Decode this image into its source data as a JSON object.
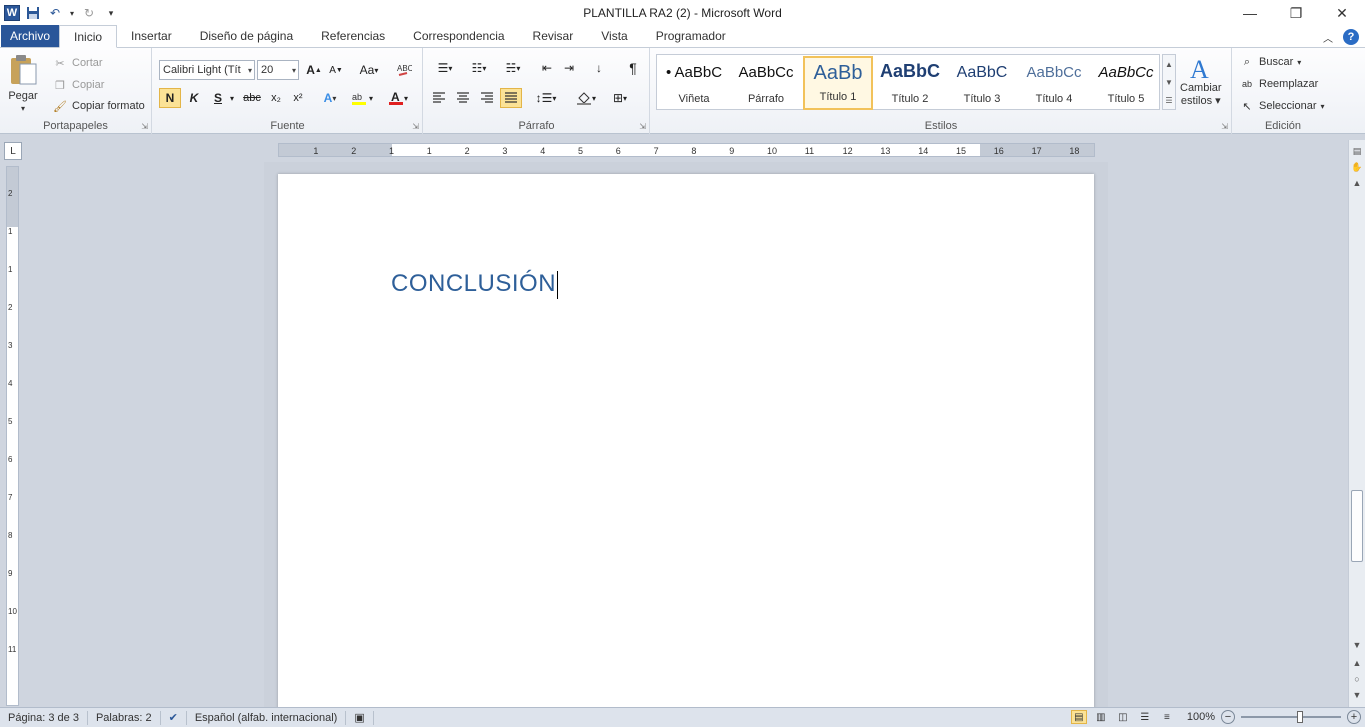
{
  "window": {
    "title": "PLANTILLA RA2 (2)  -  Microsoft Word",
    "app_logo": "W",
    "controls": {
      "minimize": "—",
      "restore": "❐",
      "close": "✕"
    }
  },
  "tabs": [
    {
      "label": "Archivo"
    },
    {
      "label": "Inicio"
    },
    {
      "label": "Insertar"
    },
    {
      "label": "Diseño de página"
    },
    {
      "label": "Referencias"
    },
    {
      "label": "Correspondencia"
    },
    {
      "label": "Revisar"
    },
    {
      "label": "Vista"
    },
    {
      "label": "Programador"
    }
  ],
  "ribbon": {
    "clipboard": {
      "label": "Portapapeles",
      "paste": "Pegar",
      "cut": "Cortar",
      "copy": "Copiar",
      "format_painter": "Copiar formato"
    },
    "font": {
      "label": "Fuente",
      "font_name": "Calibri Light (Tít",
      "font_size": "20",
      "bold": "N",
      "italic": "K",
      "underline": "S",
      "strike": "abc",
      "subscript": "x₂",
      "superscript": "x²",
      "grow": "A",
      "shrink": "A",
      "case": "Aa"
    },
    "paragraph": {
      "label": "Párrafo",
      "pilcrow": "¶"
    },
    "styles": {
      "label": "Estilos",
      "items": [
        {
          "preview": "• AaBbC",
          "name": "Viñeta"
        },
        {
          "preview": "AaBbCc",
          "name": "Párrafo"
        },
        {
          "preview": "AaBb",
          "name": "Título 1"
        },
        {
          "preview": "AaBbC",
          "name": "Título 2"
        },
        {
          "preview": "AaBbC",
          "name": "Título 3"
        },
        {
          "preview": "AaBbCc",
          "name": "Título 4"
        },
        {
          "preview": "AaBbCc",
          "name": "Título 5"
        }
      ],
      "change_styles_1": "Cambiar",
      "change_styles_2": "estilos"
    },
    "editing": {
      "label": "Edición",
      "find": "Buscar",
      "replace": "Reemplazar",
      "select": "Seleccionar"
    }
  },
  "ruler": {
    "h_ticks": [
      "1",
      "2",
      "1",
      "1",
      "2",
      "3",
      "4",
      "5",
      "6",
      "7",
      "8",
      "9",
      "10",
      "11",
      "12",
      "13",
      "14",
      "15",
      "16",
      "17",
      "18"
    ],
    "v_ticks": [
      "2",
      "1",
      "1",
      "2",
      "3",
      "4",
      "5",
      "6",
      "7",
      "8",
      "9",
      "10",
      "11"
    ],
    "corner": "L"
  },
  "document": {
    "heading": "CONCLUSIÓN"
  },
  "statusbar": {
    "page": "Página: 3 de 3",
    "words": "Palabras: 2",
    "language": "Español (alfab. internacional)",
    "zoom": "100%"
  }
}
